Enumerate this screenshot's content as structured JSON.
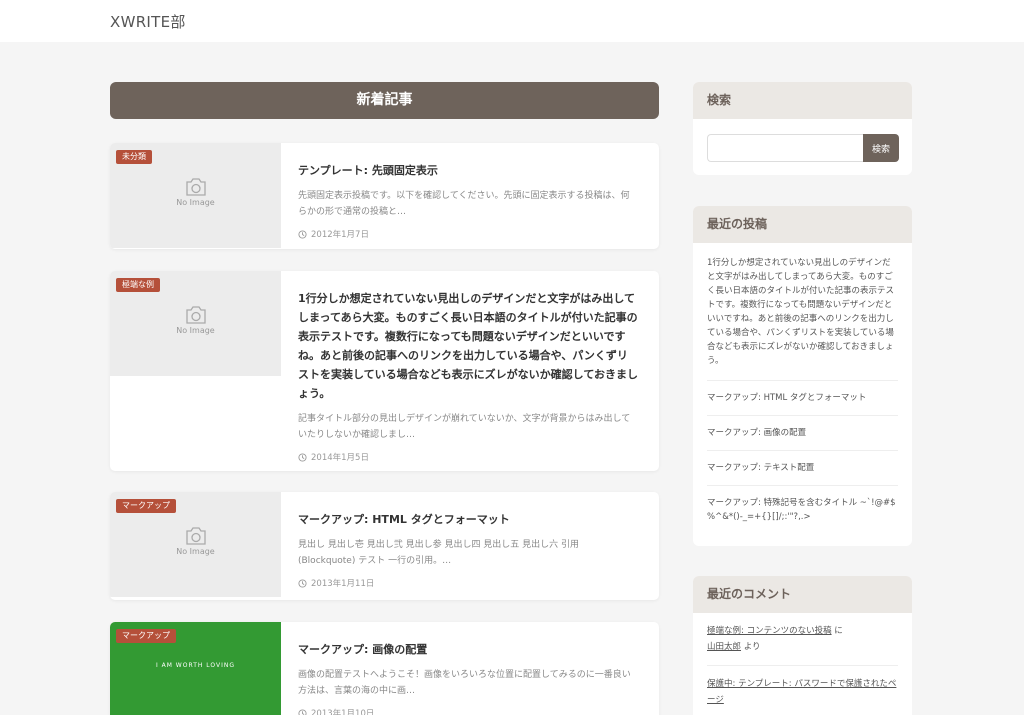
{
  "site": {
    "title": "XWRITE部"
  },
  "main": {
    "section_title": "新着記事",
    "posts": [
      {
        "category": "未分類",
        "no_image": "No Image",
        "title": "テンプレート: 先頭固定表示",
        "excerpt": "先頭固定表示投稿です。以下を確認してください。先頭に固定表示する投稿は、何らかの形で通常の投稿と…",
        "date": "2012年1月7日"
      },
      {
        "category": "極端な例",
        "no_image": "No Image",
        "title": "1行分しか想定されていない見出しのデザインだと文字がはみ出してしまってあら大変。ものすごく長い日本語のタイトルが付いた記事の表示テストです。複数行になっても問題ないデザインだといいですね。あと前後の記事へのリンクを出力している場合や、パンくずリストを実装している場合なども表示にズレがないか確認しておきましょう。",
        "excerpt": "記事タイトル部分の見出しデザインが崩れていないか、文字が背景からはみ出していたりしないか確認しまし…",
        "date": "2014年1月5日"
      },
      {
        "category": "マークアップ",
        "no_image": "No Image",
        "title": "マークアップ: HTML タグとフォーマット",
        "excerpt": "見出し 見出し壱 見出し弐 見出し参 見出し四 見出し五 見出し六 引用 (Blockquote) テスト 一行の引用。…",
        "date": "2013年1月11日"
      },
      {
        "category": "マークアップ",
        "thumb_text": "I AM WORTH LOVING",
        "title": "マークアップ: 画像の配置",
        "excerpt": "画像の配置テストへようこそ！画像をいろいろな位置に配置してみるのに一番良い方法は、言葉の海の中に画…",
        "date": "2013年1月10日"
      }
    ]
  },
  "sidebar": {
    "search": {
      "title": "検索",
      "button": "検索",
      "placeholder": ""
    },
    "recent_posts": {
      "title": "最近の投稿",
      "items": [
        "1行分しか想定されていない見出しのデザインだと文字がはみ出してしまってあら大変。ものすごく長い日本語のタイトルが付いた記事の表示テストです。複数行になっても問題ないデザインだといいですね。あと前後の記事へのリンクを出力している場合や、パンくずリストを実装している場合なども表示にズレがないか確認しておきましょう。",
        "マークアップ: HTML タグとフォーマット",
        "マークアップ: 画像の配置",
        "マークアップ: テキスト配置",
        "マークアップ: 特殊記号を含むタイトル ~`!@#$%^&*()-_=+{}[]/;:'\"?,.>"
      ]
    },
    "recent_comments": {
      "title": "最近のコメント",
      "items": [
        {
          "post": "極端な例: コンテンツのない投稿",
          "on": "に",
          "author": "山田太郎",
          "by": "より"
        },
        {
          "post": "保護中: テンプレート: パスワードで保護されたページ"
        }
      ]
    }
  },
  "icons": {
    "camera": "camera-icon",
    "clock": "clock-icon"
  },
  "colors": {
    "accent": "#6e635b",
    "category": "#b5503a",
    "widget_header": "#ebe8e4",
    "green_thumb": "#339a33"
  }
}
